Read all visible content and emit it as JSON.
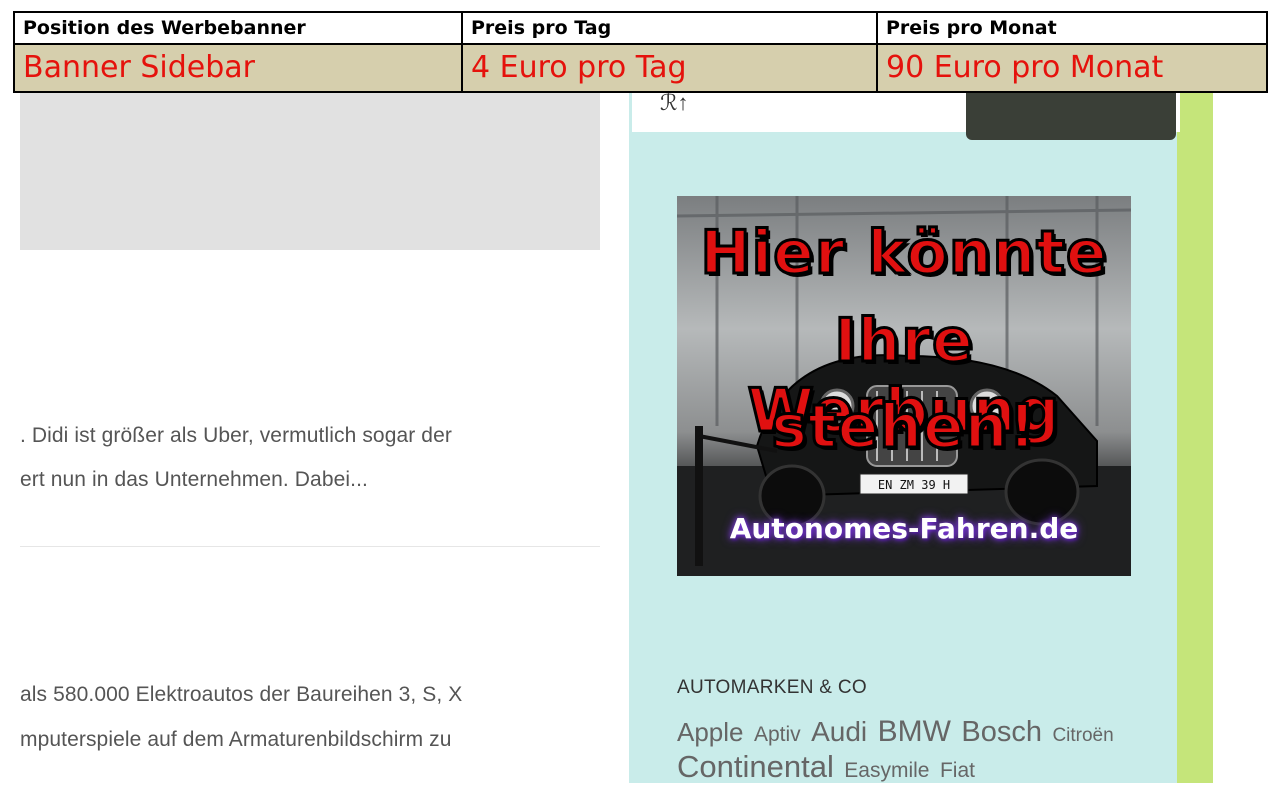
{
  "table": {
    "headers": [
      "Position des Werbebanner",
      "Preis pro Tag",
      "Preis pro Monat"
    ],
    "row": [
      "Banner Sidebar",
      "4 Euro pro Tag",
      "90 Euro pro Monat"
    ]
  },
  "article": {
    "excerpt1_line1": ". Didi ist größer als Uber, vermutlich sogar der",
    "excerpt1_line2": "ert nun in das Unternehmen. Dabei...",
    "excerpt2_line1": "als 580.000 Elektroautos der Baureihen 3, S, X",
    "excerpt2_line2": "mputerspiele auf dem Armaturenbildschirm zu"
  },
  "sidebar": {
    "ad": {
      "line1": "Hier könnte",
      "line2": "Ihre Werbung",
      "line3": "stehen!",
      "domain": "Autonomes-Fahren.de",
      "plate": "EN ZM 39 H"
    },
    "tags_heading": "AUTOMARKEN & CO",
    "tags": [
      {
        "label": "Apple",
        "size": 26
      },
      {
        "label": "Aptiv",
        "size": 21
      },
      {
        "label": "Audi",
        "size": 28
      },
      {
        "label": "BMW",
        "size": 30
      },
      {
        "label": "Bosch",
        "size": 29
      },
      {
        "label": "Citroën",
        "size": 19
      },
      {
        "label": "Continental",
        "size": 31
      },
      {
        "label": "Easymile",
        "size": 21
      },
      {
        "label": "Fiat",
        "size": 21
      }
    ]
  },
  "colors": {
    "table_value_bg": "#d6cfad",
    "table_value_text": "#e5120c",
    "sidebar_bg": "#c9ecea",
    "green_strip": "#c5e57a",
    "ad_text": "#e01010"
  }
}
